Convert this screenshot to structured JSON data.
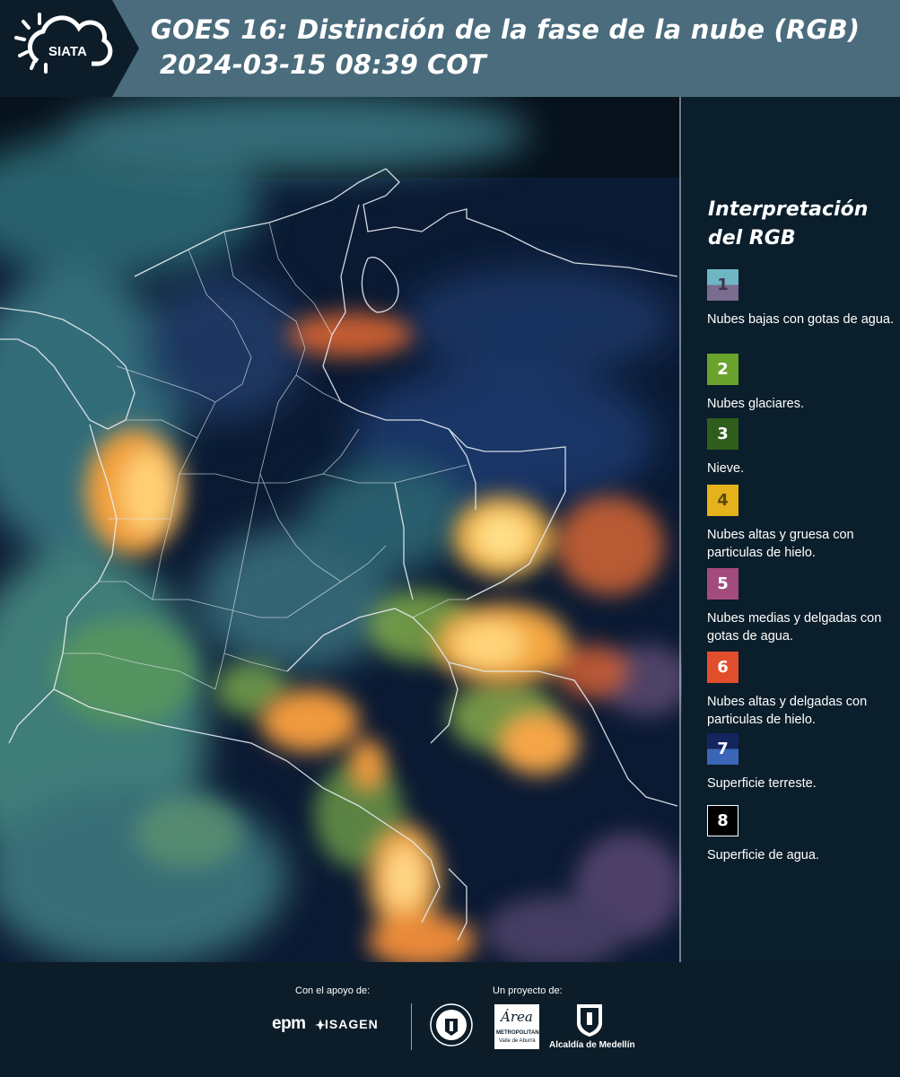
{
  "header": {
    "logo_text": "SIATA",
    "title_line1": "GOES 16: Distinción de la fase de la nube (RGB)",
    "title_line2": "2024-03-15 08:39 COT"
  },
  "legend": {
    "title": "Interpretación del RGB",
    "items": [
      {
        "number": "1",
        "description": "Nubes bajas con gotas de agua.",
        "color_top": "#6fb6c4",
        "color_bottom": "#7a6b8f",
        "text_color": "#3d3550"
      },
      {
        "number": "2",
        "description": "Nubes glaciares.",
        "color_top": "#6aa32c",
        "color_bottom": "#6aa32c",
        "text_color": "#ffffff"
      },
      {
        "number": "3",
        "description": "Nieve.",
        "color_top": "#2f5e1c",
        "color_bottom": "#2f5e1c",
        "text_color": "#ffffff"
      },
      {
        "number": "4",
        "description": "Nubes altas y gruesa con particulas de hielo.",
        "color_top": "#e5b21c",
        "color_bottom": "#e5b21c",
        "text_color": "#5a4a10"
      },
      {
        "number": "5",
        "description": "Nubes medias y delgadas con gotas de agua.",
        "color_top": "#a44b7e",
        "color_bottom": "#a44b7e",
        "text_color": "#ffffff"
      },
      {
        "number": "6",
        "description": "Nubes altas y delgadas con particulas de hielo.",
        "color_top": "#e24e2b",
        "color_bottom": "#e24e2b",
        "text_color": "#ffffff"
      },
      {
        "number": "7",
        "description": "Superficie terreste.",
        "color_top": "#14245e",
        "color_bottom": "#3b66b8",
        "text_color": "#ffffff"
      },
      {
        "number": "8",
        "description": "Superficie de agua.",
        "color_top": "#000000",
        "color_bottom": "#000000",
        "text_color": "#ffffff"
      }
    ]
  },
  "footer": {
    "support_label": "Con el apoyo de:",
    "project_label": "Un proyecto de:",
    "epm": "epm",
    "isagen": "ISAGEN",
    "area_metropolitana": "Área",
    "area_sub": "METROPOLITANA",
    "area_sub2": "Valle de Aburrá",
    "alcaldia": "Alcaldía de Medellín"
  },
  "colors": {
    "header_bg": "#4a6c7c",
    "logo_bg": "#0c1d29",
    "page_bg": "#0c1d29"
  }
}
